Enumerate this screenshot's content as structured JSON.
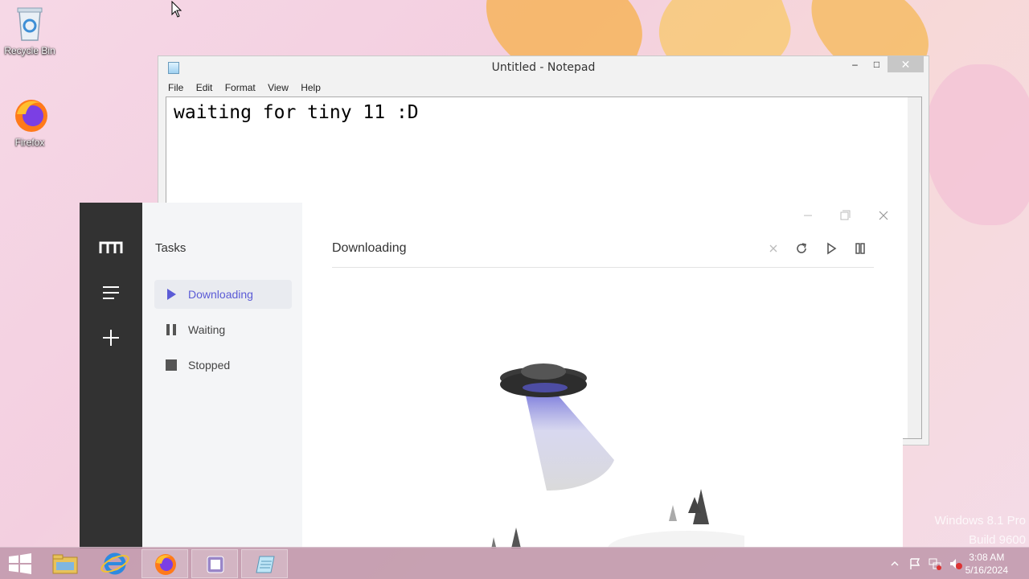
{
  "desktop": {
    "icons": [
      {
        "label": "Recycle Bin"
      },
      {
        "label": "Firefox"
      }
    ],
    "watermark": {
      "line1": "Windows 8.1 Pro",
      "line2": "Build 9600"
    }
  },
  "notepad": {
    "title": "Untitled - Notepad",
    "menu": [
      "File",
      "Edit",
      "Format",
      "View",
      "Help"
    ],
    "content": "waiting for tiny 11 :D",
    "controls": {
      "minimize": "–",
      "maximize": "□",
      "close": "✕"
    }
  },
  "motrix": {
    "sidebar_title": "Tasks",
    "sidebar_items": [
      {
        "label": "Downloading",
        "icon": "play-icon",
        "active": true
      },
      {
        "label": "Waiting",
        "icon": "pause-icon",
        "active": false
      },
      {
        "label": "Stopped",
        "icon": "stop-icon",
        "active": false
      }
    ],
    "main_title": "Downloading",
    "accent": "#5b5bd6",
    "rail": [
      "logo-icon",
      "menu-icon",
      "add-icon"
    ],
    "toolbar": [
      "close-icon",
      "refresh-icon",
      "play-icon",
      "pause-icon"
    ]
  },
  "taskbar": {
    "apps": [
      "file-explorer-icon",
      "internet-explorer-icon",
      "firefox-icon",
      "motrix-icon",
      "notepad-icon"
    ],
    "clock": {
      "time": "3:08 AM",
      "date": "5/16/2024"
    }
  }
}
